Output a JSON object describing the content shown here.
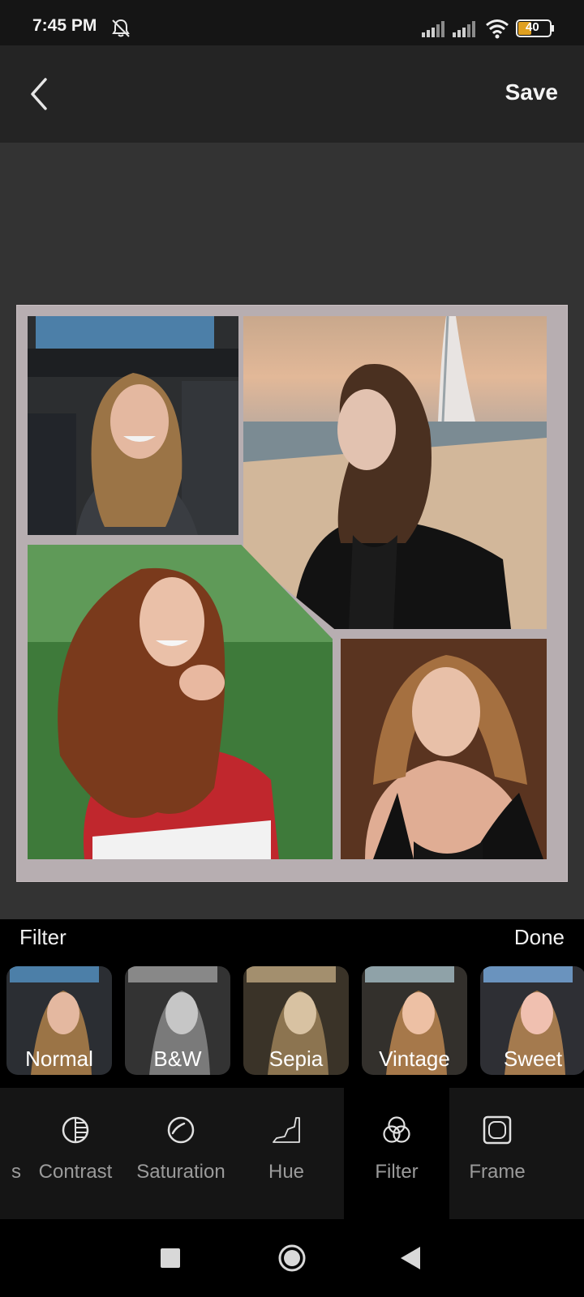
{
  "status_bar": {
    "time": "7:45 PM",
    "battery": "40",
    "icons": [
      "mute-icon",
      "signal-icon",
      "signal-icon",
      "wifi-icon",
      "battery-icon"
    ]
  },
  "app_bar": {
    "back_icon": "back-arrow-icon",
    "save_label": "Save"
  },
  "collage": {
    "frame_color": "#b7aeb1",
    "photos": [
      "collage-photo-1",
      "collage-photo-2",
      "collage-photo-3",
      "collage-photo-4"
    ]
  },
  "filter_panel": {
    "title": "Filter",
    "done_label": "Done",
    "filters": [
      {
        "label": "Normal"
      },
      {
        "label": "B&W"
      },
      {
        "label": "Sepia"
      },
      {
        "label": "Vintage"
      },
      {
        "label": "Sweet"
      }
    ]
  },
  "tools": {
    "partial_label": "s",
    "items": [
      {
        "label": "Contrast",
        "icon": "contrast-icon"
      },
      {
        "label": "Saturation",
        "icon": "saturation-icon"
      },
      {
        "label": "Hue",
        "icon": "hue-icon"
      },
      {
        "label": "Filter",
        "icon": "filter-icon",
        "active": true
      },
      {
        "label": "Frame",
        "icon": "frame-icon"
      }
    ]
  },
  "nav_bar": {
    "icons": [
      "recents-square-icon",
      "home-circle-icon",
      "back-triangle-icon"
    ]
  }
}
